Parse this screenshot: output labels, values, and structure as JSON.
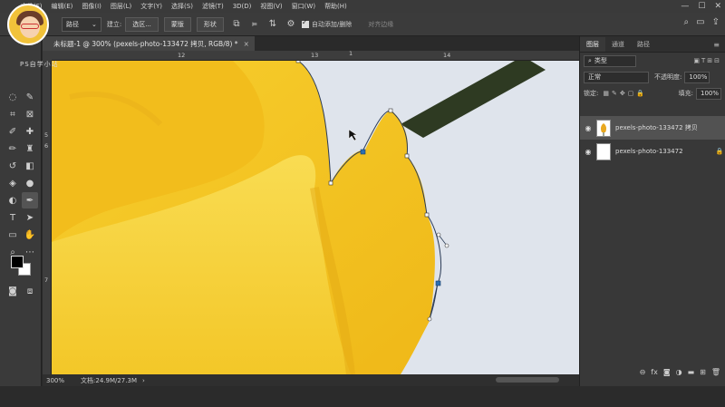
{
  "menu": [
    "文件(F)",
    "编辑(E)",
    "图像(I)",
    "图层(L)",
    "文字(Y)",
    "选择(S)",
    "滤镜(T)",
    "3D(D)",
    "视图(V)",
    "窗口(W)",
    "帮助(H)"
  ],
  "options": {
    "mode": "路径",
    "build_label": "建立:",
    "selection_btn": "选区...",
    "mask_btn": "蒙版",
    "shape_btn": "形状",
    "auto_add_delete": "自动添加/删除",
    "align_edges": "对齐边缘"
  },
  "brand": "PS自学小站",
  "document": {
    "tab_title": "未标题-1 @ 300% (pexels-photo-133472 拷贝, RGB/8) *",
    "close": "×"
  },
  "rulers": {
    "h_labels": [
      "12",
      "13",
      "1",
      "14"
    ],
    "v_labels": [
      "5",
      "6",
      "7"
    ]
  },
  "status": {
    "zoom": "300%",
    "doc": "文档:24.9M/27.3M"
  },
  "panel": {
    "tabs": [
      "图层",
      "通道",
      "路径"
    ],
    "filter": "类型",
    "blend_mode": "正常",
    "opacity_label": "不透明度:",
    "opacity": "100%",
    "lock_label": "锁定:",
    "fill_label": "填充:",
    "fill": "100%",
    "layers": [
      {
        "name": "pexels-photo-133472 拷贝",
        "selected": true
      },
      {
        "name": "pexels-photo-133472",
        "selected": false
      }
    ]
  },
  "colors": {
    "flower_main": "#f4c21d",
    "flower_light": "#f9d94a",
    "flower_shadow": "#e0a812",
    "sky": "#dfe4ec",
    "stem": "#2e3a22",
    "path": "#2d6fb3"
  }
}
